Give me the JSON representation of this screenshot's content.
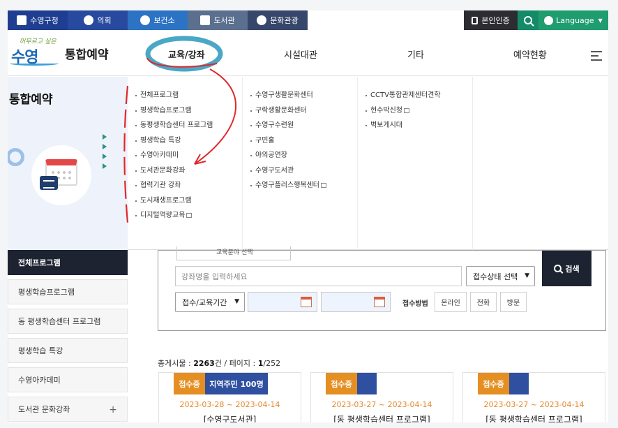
{
  "utility": {
    "links": [
      "수영구청",
      "의회",
      "보건소",
      "도서관",
      "문화관광"
    ],
    "auth": "본인인증",
    "language": "Language"
  },
  "header": {
    "logo_text": "수영",
    "logo_script": "머무르고 싶은",
    "brand": "통합예약",
    "menu": [
      "교육/강좌",
      "시설대관",
      "기타",
      "예약현황"
    ]
  },
  "dropdown": {
    "title": "통합예약",
    "col_edu": [
      "전체프로그램",
      "평생학습프로그램",
      "동평생학습센터 프로그램",
      "평생학습 특강",
      "수영아카데미",
      "도서관문화강좌",
      "협력기관 강좌",
      "도시재생프로그램",
      "디지털역량교육"
    ],
    "col_facility": [
      "수영구생활문화센터",
      "구락생활문화센터",
      "수영구수련원",
      "구민홀",
      "야외공연장",
      "수영구도서관",
      "수영구플러스행복센터"
    ],
    "col_etc": [
      "CCTV통합관제센터견학",
      "현수막신청",
      "벽보게시대"
    ]
  },
  "lnb": [
    "전체프로그램",
    "평생학습프로그램",
    "동 평생학습센터 프로그램",
    "평생학습 특강",
    "수영아카데미",
    "도서관 문화강좌"
  ],
  "search": {
    "stub_label": "교육분야 선택",
    "keyword_placeholder": "강좌명을 입력하세요",
    "status_select": "접수상태 선택",
    "period_select": "접수/교육기간",
    "method_label": "접수방법",
    "methods": [
      "온라인",
      "전화",
      "방문"
    ],
    "button": "검색"
  },
  "total": {
    "prefix": "총게시물 : ",
    "count": "2263",
    "mid": "건 / 페이지 : ",
    "page": "1",
    "pages": "/252"
  },
  "cards": [
    {
      "status": "접수중",
      "target": "지역주민 100명",
      "date": "2023-03-28 ~ 2023-04-14",
      "title": "[수영구도서관]"
    },
    {
      "status": "접수중",
      "target": "",
      "date": "2023-03-27 ~ 2023-04-14",
      "title": "[동 평생학습센터 프로그램]"
    },
    {
      "status": "접수중",
      "target": "",
      "date": "2023-03-27 ~ 2023-04-14",
      "title": "[동 평생학습센터 프로그램]"
    }
  ],
  "colors": {
    "annotation": "#e0282c",
    "ring": "#4aa7c6",
    "accent_orange": "#e58f22",
    "accent_blue": "#2f4fa0",
    "dark": "#1d2330"
  }
}
